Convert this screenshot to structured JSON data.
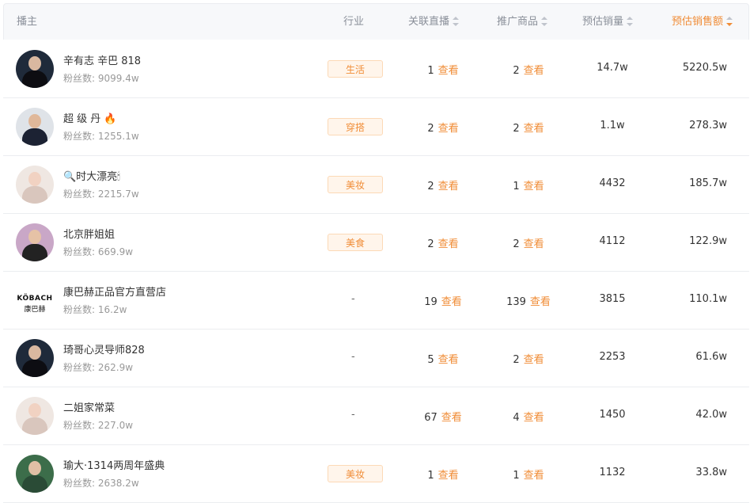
{
  "header": {
    "anchor": "播主",
    "industry": "行业",
    "related_live": "关联直播",
    "promoted_goods": "推广商品",
    "est_sales_volume": "预估销量",
    "est_sales_amount": "预估销售额"
  },
  "accent_color": "#f08c36",
  "fans_prefix": "粉丝数: ",
  "view_label": "查看",
  "rows": [
    {
      "name": "辛有志 辛巴 818",
      "fans": "9099.4w",
      "industry": "生活",
      "live": "1",
      "goods": "2",
      "volume": "14.7w",
      "amount": "5220.5w",
      "avatar": "photo-dark"
    },
    {
      "name": "超 级 丹 🔥",
      "fans": "1255.1w",
      "industry": "穿搭",
      "live": "2",
      "goods": "2",
      "volume": "1.1w",
      "amount": "278.3w",
      "avatar": "photo-suit"
    },
    {
      "name": "🔍时大漂亮🕯",
      "fans": "2215.7w",
      "industry": "美妆",
      "live": "2",
      "goods": "1",
      "volume": "4432",
      "amount": "185.7w",
      "avatar": "photo-light"
    },
    {
      "name": "北京胖姐姐",
      "fans": "669.9w",
      "industry": "美食",
      "live": "2",
      "goods": "2",
      "volume": "4112",
      "amount": "122.9w",
      "avatar": "photo-pink"
    },
    {
      "name": "康巴赫正品官方直营店",
      "fans": "16.2w",
      "industry": "-",
      "live": "19",
      "goods": "139",
      "volume": "3815",
      "amount": "110.1w",
      "avatar": "logo",
      "logo_line1": "KÖBACH",
      "logo_line2": "康巴赫"
    },
    {
      "name": "琦哥心灵导师828",
      "fans": "262.9w",
      "industry": "-",
      "live": "5",
      "goods": "2",
      "volume": "2253",
      "amount": "61.6w",
      "avatar": "photo-dark"
    },
    {
      "name": "二姐家常菜",
      "fans": "227.0w",
      "industry": "-",
      "live": "67",
      "goods": "4",
      "volume": "1450",
      "amount": "42.0w",
      "avatar": "photo-light"
    },
    {
      "name": "瑜大·1314两周年盛典",
      "fans": "2638.2w",
      "industry": "美妆",
      "live": "1",
      "goods": "1",
      "volume": "1132",
      "amount": "33.8w",
      "avatar": "photo-green"
    }
  ]
}
